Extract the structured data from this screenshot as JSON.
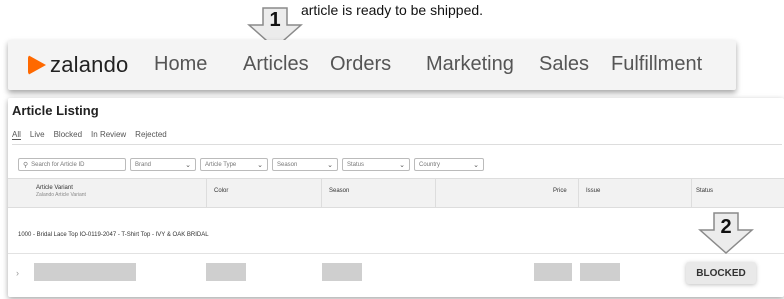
{
  "caption": "article is ready to be shipped.",
  "nav": {
    "logo_text": "zalando",
    "items": [
      "Home",
      "Articles",
      "Orders",
      "Marketing",
      "Sales",
      "Fulfillment"
    ]
  },
  "callouts": [
    "1",
    "2"
  ],
  "listing": {
    "title": "Article Listing",
    "tabs": [
      "All",
      "Live",
      "Blocked",
      "In Review",
      "Rejected"
    ],
    "filters": {
      "search_placeholder": "Search for Article ID",
      "brand": "Brand",
      "article_type": "Article Type",
      "season": "Season",
      "status": "Status",
      "country": "Country"
    },
    "columns": {
      "variant": "Article Variant",
      "variant_sub": "Zalando Article Variant",
      "color": "Color",
      "season": "Season",
      "price": "Price",
      "issue": "Issue",
      "status": "Status"
    },
    "group_label": "1000 - Bridal Lace Top IO-0119-2047 - T-Shirt Top - IVY & OAK BRIDAL",
    "row": {
      "status_badge": "BLOCKED"
    }
  },
  "colors": {
    "brand": "#ff6900",
    "arrow_fill": "#e8e8e8",
    "arrow_stroke": "#888888"
  }
}
